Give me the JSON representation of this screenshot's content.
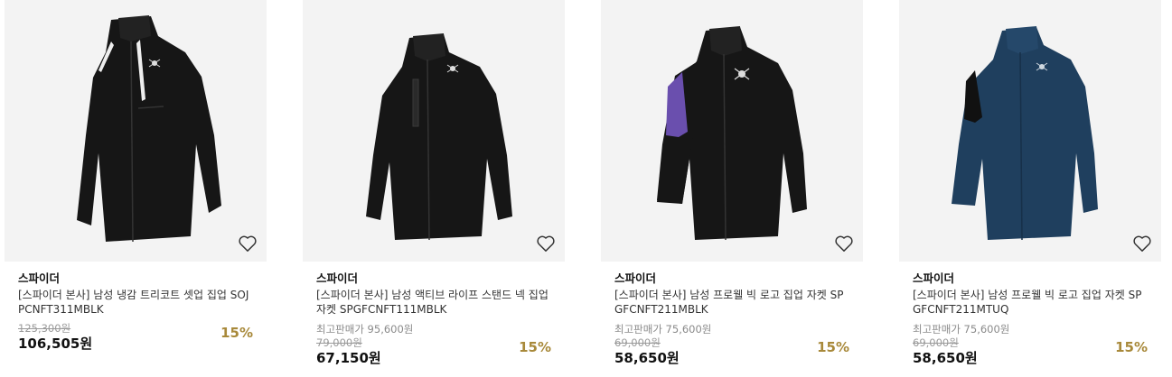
{
  "products": [
    {
      "brand": "스파이더",
      "name": "[스파이더 본사] 남성 냉감 트리코트 셋업 집업 SOJPCNFT311MBLK",
      "original_price": "125,300원",
      "sale_price": "106,505원",
      "discount": "15%",
      "wishlist_icon": "heart-outline-icon"
    },
    {
      "brand": "스파이더",
      "name": "[스파이더 본사] 남성 액티브 라이프 스탠드 넥 집업 자켓 SPGFCNFT111MBLK",
      "max_price": "최고판매가 95,600원",
      "original_price": "79,000원",
      "sale_price": "67,150원",
      "discount": "15%",
      "wishlist_icon": "heart-outline-icon"
    },
    {
      "brand": "스파이더",
      "name": "[스파이더 본사] 남성 프로웰 빅 로고 집업 자켓 SPGFCNFT211MBLK",
      "max_price": "최고판매가 75,600원",
      "original_price": "69,000원",
      "sale_price": "58,650원",
      "discount": "15%",
      "wishlist_icon": "heart-outline-icon"
    },
    {
      "brand": "스파이더",
      "name": "[스파이더 본사] 남성 프로웰 빅 로고 집업 자켓 SPGFCNFT211MTUQ",
      "max_price": "최고판매가 75,600원",
      "original_price": "69,000원",
      "sale_price": "58,650원",
      "discount": "15%",
      "wishlist_icon": "heart-outline-icon"
    }
  ],
  "colors": {
    "discount": "#a8893a",
    "thumb_bg": "#f3f3f3",
    "jacket_black": "#161616",
    "jacket_navy": "#1f3f5e",
    "accent_purple": "#6a4fae"
  }
}
